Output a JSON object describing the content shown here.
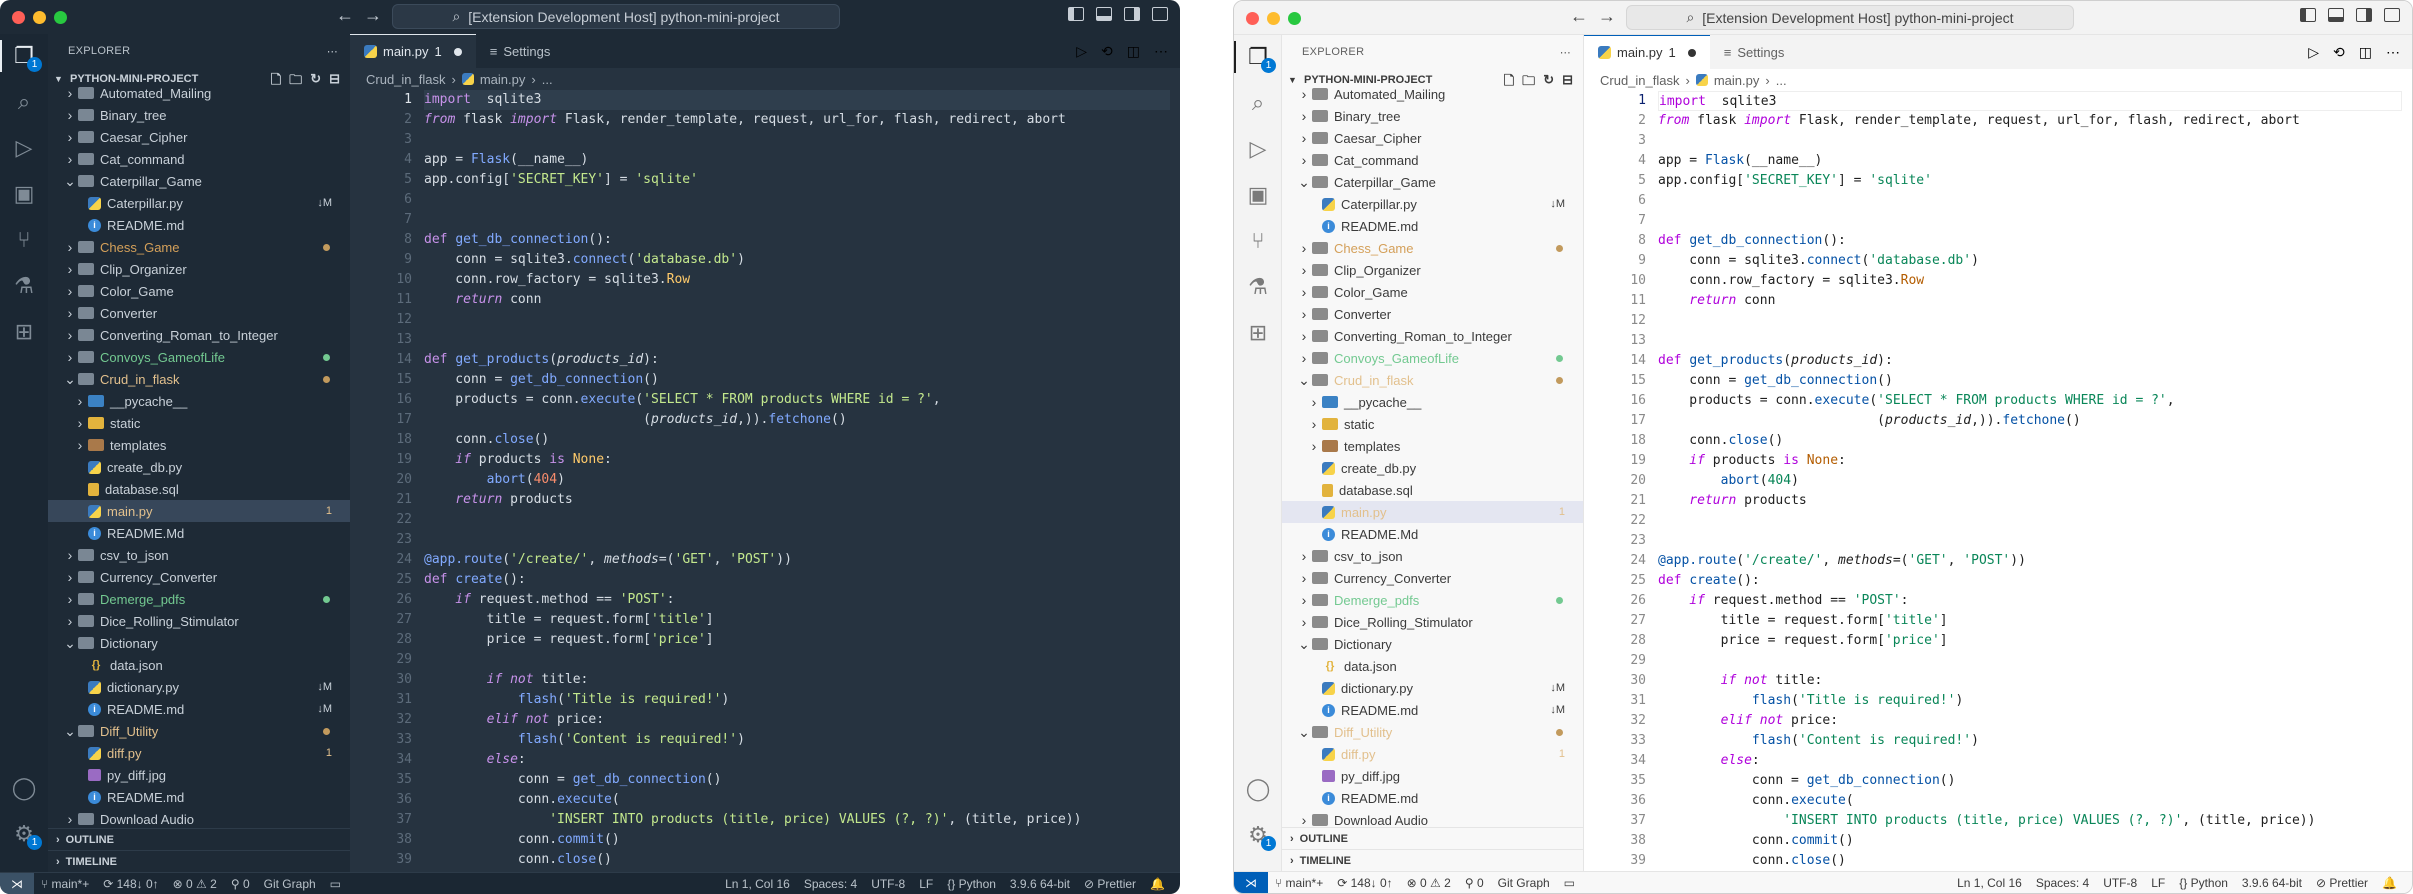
{
  "title": "[Extension Development Host] python-mini-project",
  "explorer": {
    "title": "EXPLORER",
    "project": "PYTHON-MINI-PROJECT",
    "outline": "OUTLINE",
    "timeline": "TIMELINE",
    "items": [
      {
        "label": "Automated_Mailing",
        "type": "folder",
        "depth": 0,
        "open": false,
        "color": "",
        "status": ""
      },
      {
        "label": "Binary_tree",
        "type": "folder",
        "depth": 0,
        "open": false,
        "color": "",
        "status": ""
      },
      {
        "label": "Caesar_Cipher",
        "type": "folder",
        "depth": 0,
        "open": false,
        "color": "",
        "status": ""
      },
      {
        "label": "Cat_command",
        "type": "folder",
        "depth": 0,
        "open": false,
        "color": "",
        "status": ""
      },
      {
        "label": "Caterpillar_Game",
        "type": "folder",
        "depth": 0,
        "open": true,
        "color": "",
        "status": ""
      },
      {
        "label": "Caterpillar.py",
        "type": "py",
        "depth": 1,
        "color": "",
        "status": "↓M"
      },
      {
        "label": "README.md",
        "type": "info",
        "depth": 1,
        "color": "",
        "status": ""
      },
      {
        "label": "Chess_Game",
        "type": "folder",
        "depth": 0,
        "open": false,
        "color": "orange",
        "status": "dot"
      },
      {
        "label": "Clip_Organizer",
        "type": "folder",
        "depth": 0,
        "open": false,
        "color": "",
        "status": ""
      },
      {
        "label": "Color_Game",
        "type": "folder",
        "depth": 0,
        "open": false,
        "color": "",
        "status": ""
      },
      {
        "label": "Converter",
        "type": "folder",
        "depth": 0,
        "open": false,
        "color": "",
        "status": ""
      },
      {
        "label": "Converting_Roman_to_Integer",
        "type": "folder",
        "depth": 0,
        "open": false,
        "color": "",
        "status": ""
      },
      {
        "label": "Convoys_GameofLife",
        "type": "folder",
        "depth": 0,
        "open": false,
        "color": "green",
        "status": "dotg"
      },
      {
        "label": "Crud_in_flask",
        "type": "folder",
        "depth": 0,
        "open": true,
        "color": "yellow",
        "status": "dot"
      },
      {
        "label": "__pycache__",
        "type": "folderblue",
        "depth": 1,
        "open": false,
        "color": "",
        "status": ""
      },
      {
        "label": "static",
        "type": "folderyellow",
        "depth": 1,
        "open": false,
        "color": "",
        "status": ""
      },
      {
        "label": "templates",
        "type": "folderbrown",
        "depth": 1,
        "open": false,
        "color": "",
        "status": ""
      },
      {
        "label": "create_db.py",
        "type": "py",
        "depth": 1,
        "color": "",
        "status": ""
      },
      {
        "label": "database.sql",
        "type": "sql",
        "depth": 1,
        "color": "",
        "status": ""
      },
      {
        "label": "main.py",
        "type": "py",
        "depth": 1,
        "color": "yellow",
        "status": "1",
        "selected": true
      },
      {
        "label": "README.Md",
        "type": "info",
        "depth": 1,
        "color": "",
        "status": ""
      },
      {
        "label": "csv_to_json",
        "type": "folder",
        "depth": 0,
        "open": false,
        "color": "",
        "status": ""
      },
      {
        "label": "Currency_Converter",
        "type": "folder",
        "depth": 0,
        "open": false,
        "color": "",
        "status": ""
      },
      {
        "label": "Demerge_pdfs",
        "type": "folder",
        "depth": 0,
        "open": false,
        "color": "green",
        "status": "dotg"
      },
      {
        "label": "Dice_Rolling_Stimulator",
        "type": "folder",
        "depth": 0,
        "open": false,
        "color": "",
        "status": ""
      },
      {
        "label": "Dictionary",
        "type": "folder",
        "depth": 0,
        "open": true,
        "color": "",
        "status": ""
      },
      {
        "label": "data.json",
        "type": "json",
        "depth": 1,
        "color": "",
        "status": ""
      },
      {
        "label": "dictionary.py",
        "type": "py",
        "depth": 1,
        "color": "",
        "status": "↓M"
      },
      {
        "label": "README.md",
        "type": "info",
        "depth": 1,
        "color": "",
        "status": "↓M"
      },
      {
        "label": "Diff_Utility",
        "type": "folder",
        "depth": 0,
        "open": true,
        "color": "yellow",
        "status": "dot"
      },
      {
        "label": "diff.py",
        "type": "py",
        "depth": 1,
        "color": "yellow",
        "status": "1"
      },
      {
        "label": "py_diff.jpg",
        "type": "img",
        "depth": 1,
        "color": "",
        "status": ""
      },
      {
        "label": "README.md",
        "type": "info",
        "depth": 1,
        "color": "",
        "status": ""
      },
      {
        "label": "Download Audio",
        "type": "folder",
        "depth": 0,
        "open": false,
        "color": "",
        "status": ""
      }
    ]
  },
  "tabs": [
    {
      "label": "main.py",
      "extra": "1",
      "modified": true,
      "active": true
    },
    {
      "label": "Settings",
      "extra": "",
      "modified": false,
      "active": false
    }
  ],
  "breadcrumbs": [
    "Crud_in_flask",
    "main.py",
    "..."
  ],
  "editor": {
    "current_line": 1,
    "lines": [
      [
        [
          "k2",
          "import"
        ],
        [
          "",
          "  "
        ],
        [
          "",
          "sqlite3"
        ]
      ],
      [
        [
          "k",
          "from"
        ],
        [
          "",
          " flask "
        ],
        [
          "k",
          "import"
        ],
        [
          "",
          " Flask, render_template, request, url_for, flash, redirect, abort"
        ]
      ],
      [],
      [
        [
          "",
          "app = "
        ],
        [
          "f",
          "Flask"
        ],
        [
          "",
          "(__name__)"
        ]
      ],
      [
        [
          "",
          "app.config["
        ],
        [
          "s",
          "'SECRET_KEY'"
        ],
        [
          "",
          "] = "
        ],
        [
          "s",
          "'sqlite'"
        ]
      ],
      [],
      [],
      [
        [
          "k2",
          "def"
        ],
        [
          "",
          " "
        ],
        [
          "f",
          "get_db_connection"
        ],
        [
          "",
          "():"
        ]
      ],
      [
        [
          "",
          "    conn = sqlite3."
        ],
        [
          "f",
          "connect"
        ],
        [
          "",
          "("
        ],
        [
          "s",
          "'database.db'"
        ],
        [
          "",
          ")"
        ]
      ],
      [
        [
          "",
          "    conn.row_factory = sqlite3."
        ],
        [
          "c",
          "Row"
        ]
      ],
      [
        [
          "k",
          "    return"
        ],
        [
          "",
          " conn"
        ]
      ],
      [],
      [],
      [
        [
          "k2",
          "def"
        ],
        [
          "",
          " "
        ],
        [
          "f",
          "get_products"
        ],
        [
          "",
          "("
        ],
        [
          "p",
          "products_id"
        ],
        [
          "",
          "):"
        ]
      ],
      [
        [
          "",
          "    conn = "
        ],
        [
          "f",
          "get_db_connection"
        ],
        [
          "",
          "()"
        ]
      ],
      [
        [
          "",
          "    products = conn."
        ],
        [
          "f",
          "execute"
        ],
        [
          "",
          "("
        ],
        [
          "s",
          "'SELECT * FROM products WHERE id = ?'"
        ],
        [
          "",
          ","
        ]
      ],
      [
        [
          "",
          "                            ("
        ],
        [
          "p",
          "products_id"
        ],
        [
          "",
          ",))."
        ],
        [
          "f",
          "fetchone"
        ],
        [
          "",
          "()"
        ]
      ],
      [
        [
          "",
          "    conn."
        ],
        [
          "f",
          "close"
        ],
        [
          "",
          "()"
        ]
      ],
      [
        [
          "k",
          "    if"
        ],
        [
          "",
          " products "
        ],
        [
          "k2",
          "is"
        ],
        [
          "",
          " "
        ],
        [
          "c",
          "None"
        ],
        [
          "",
          ":"
        ]
      ],
      [
        [
          "",
          "        "
        ],
        [
          "f",
          "abort"
        ],
        [
          "",
          "("
        ],
        [
          "n",
          "404"
        ],
        [
          "",
          ")"
        ]
      ],
      [
        [
          "k",
          "    return"
        ],
        [
          "",
          " products"
        ]
      ],
      [],
      [],
      [
        [
          "d",
          "@app.route"
        ],
        [
          "",
          "("
        ],
        [
          "s",
          "'/create/'"
        ],
        [
          "",
          ", "
        ],
        [
          "p",
          "methods"
        ],
        [
          "",
          "=("
        ],
        [
          "s",
          "'GET'"
        ],
        [
          "",
          ", "
        ],
        [
          "s",
          "'POST'"
        ],
        [
          "",
          "))"
        ]
      ],
      [
        [
          "k2",
          "def"
        ],
        [
          "",
          " "
        ],
        [
          "f",
          "create"
        ],
        [
          "",
          "():"
        ]
      ],
      [
        [
          "k",
          "    if"
        ],
        [
          "",
          " request.method == "
        ],
        [
          "s",
          "'POST'"
        ],
        [
          "",
          ":"
        ]
      ],
      [
        [
          "",
          "        title = request.form["
        ],
        [
          "s",
          "'title'"
        ],
        [
          "",
          "]"
        ]
      ],
      [
        [
          "",
          "        price = request.form["
        ],
        [
          "s",
          "'price'"
        ],
        [
          "",
          "]"
        ]
      ],
      [],
      [
        [
          "k",
          "        if not"
        ],
        [
          "",
          " title:"
        ]
      ],
      [
        [
          "",
          "            "
        ],
        [
          "f",
          "flash"
        ],
        [
          "",
          "("
        ],
        [
          "s",
          "'Title is required!'"
        ],
        [
          "",
          ")"
        ]
      ],
      [
        [
          "k",
          "        elif not"
        ],
        [
          "",
          " price:"
        ]
      ],
      [
        [
          "",
          "            "
        ],
        [
          "f",
          "flash"
        ],
        [
          "",
          "("
        ],
        [
          "s",
          "'Content is required!'"
        ],
        [
          "",
          ")"
        ]
      ],
      [
        [
          "k",
          "        else"
        ],
        [
          "",
          ":"
        ]
      ],
      [
        [
          "",
          "            conn = "
        ],
        [
          "f",
          "get_db_connection"
        ],
        [
          "",
          "()"
        ]
      ],
      [
        [
          "",
          "            conn."
        ],
        [
          "f",
          "execute"
        ],
        [
          "",
          "("
        ]
      ],
      [
        [
          "",
          "                "
        ],
        [
          "s",
          "'INSERT INTO products (title, price) VALUES (?, ?)'"
        ],
        [
          "",
          ", (title, price))"
        ]
      ],
      [
        [
          "",
          "            conn."
        ],
        [
          "f",
          "commit"
        ],
        [
          "",
          "()"
        ]
      ],
      [
        [
          "",
          "            conn."
        ],
        [
          "f",
          "close"
        ],
        [
          "",
          "()"
        ]
      ]
    ]
  },
  "status": {
    "branch": "main*+",
    "sync": "148↓ 0↑",
    "problems": "0 ⚠ 2",
    "ports": "0",
    "git_graph": "Git Graph",
    "position": "Ln 1, Col 16",
    "spaces": "Spaces: 4",
    "encoding": "UTF-8",
    "eol": "LF",
    "language": "Python",
    "interpreter": "3.9.6 64-bit",
    "prettier": "Prettier"
  },
  "icons": {
    "files": "files-icon",
    "search": "search-icon",
    "run": "run-debug-icon",
    "remote": "remote-explorer-icon",
    "scm": "source-control-icon",
    "test": "testing-icon",
    "extensions": "extensions-icon",
    "account": "account-icon",
    "settings": "gear-icon"
  },
  "activity_badge": "1"
}
